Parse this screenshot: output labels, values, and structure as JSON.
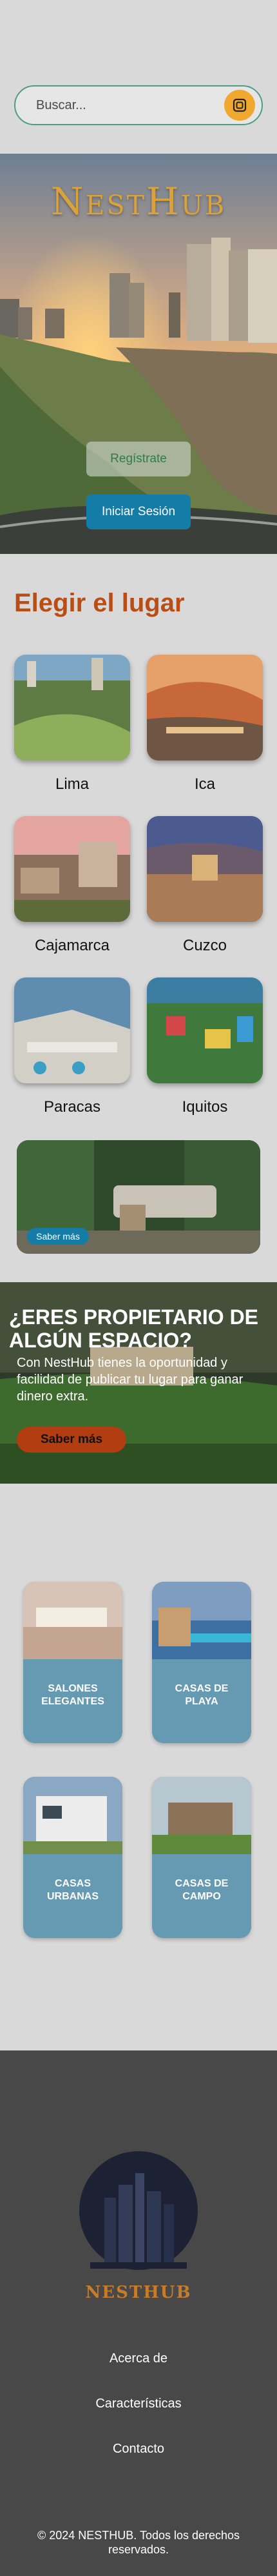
{
  "search": {
    "placeholder": "Buscar..."
  },
  "hero": {
    "brand": "NestHub",
    "register_label": "Regístrate",
    "login_label": "Iniciar Sesión"
  },
  "places": {
    "title": "Elegir el lugar",
    "items": [
      {
        "name": "Lima"
      },
      {
        "name": "Ica"
      },
      {
        "name": "Cajamarca"
      },
      {
        "name": "Cuzco"
      },
      {
        "name": "Paracas"
      },
      {
        "name": "Iquitos"
      }
    ],
    "banner_button": "Saber más"
  },
  "owner": {
    "title": "¿ERES PROPIETARIO DE ALGÚN ESPACIO?",
    "text": "Con NestHub tienes la oportunidad y facilidad de publicar tu lugar para ganar dinero extra.",
    "button": "Saber más"
  },
  "categories": [
    {
      "label": "SALONES ELEGANTES"
    },
    {
      "label": "CASAS DE PLAYA"
    },
    {
      "label": "CASAS URBANAS"
    },
    {
      "label": "CASAS DE CAMPO"
    }
  ],
  "footer": {
    "logo_text": "NESTHUB",
    "links": [
      "Acerca de",
      "Características",
      "Contacto"
    ],
    "copyright": "© 2024 NESTHUB. Todos los derechos reservados."
  },
  "colors": {
    "accent_orange": "#b94d16",
    "primary_blue": "#137ca7",
    "search_button": "#f0a82f",
    "category_card": "#6699b2",
    "footer_bg": "#484848"
  }
}
